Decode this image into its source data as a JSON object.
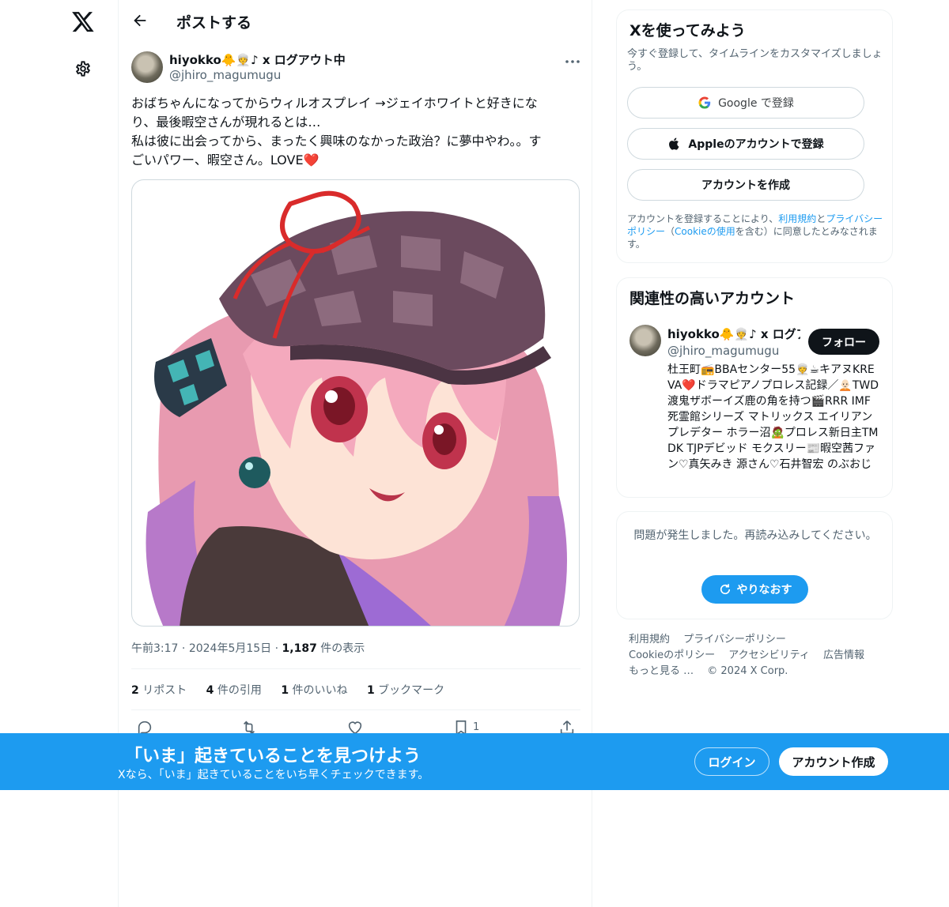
{
  "nav": {
    "logo_icon": "x-logo-icon",
    "settings_icon": "gear-icon"
  },
  "header": {
    "back_icon": "arrow-left-icon",
    "title": "ポストする"
  },
  "post": {
    "author_name": "hiyokko🐥👳‍♀️♪ x ログアウト中",
    "author_handle": "@jhiro_magumugu",
    "text": "おばちゃんになってからウィルオスプレイ →ジェイホワイトと好きにな\nり、最後暇空さんが現れるとは…\n私は彼に出会ってから、まったく興味のなかった政治？に夢中やわ。。す\nごいパワー、暇空さん。LOVE❤️",
    "time": "午前3:17",
    "date": "2024年5月15日",
    "views_count": "1,187",
    "views_label": "件の表示",
    "stats": [
      {
        "count": "2",
        "label": "リポスト"
      },
      {
        "count": "4",
        "label": "件の引用"
      },
      {
        "count": "1",
        "label": "件のいいね"
      },
      {
        "count": "1",
        "label": "ブックマーク"
      }
    ],
    "bookmark_count": "1",
    "image_alt": "anime girl with pink hair and checkered cap"
  },
  "signup_card": {
    "title": "Xを使ってみよう",
    "subtitle": "今すぐ登録して、タイムラインをカスタマイズしましょう。",
    "google_label": "Google で登録",
    "apple_label": "Appleのアカウントで登録",
    "create_label": "アカウントを作成",
    "legal_prefix": "アカウントを登録することにより、",
    "legal_terms": "利用規約",
    "legal_and": "と",
    "legal_privacy": "プライバシーポリシー",
    "legal_open": "（",
    "legal_cookie": "Cookieの使用",
    "legal_suffix": "を含む）に同意したとみなされます。"
  },
  "related_card": {
    "title": "関連性の高いアカウント",
    "name": "hiyokko🐥👳‍♀️♪ x ログアウト中",
    "handle": "@jhiro_magumugu",
    "follow_label": "フォロー",
    "bio": "杜王町📻BBAセンター55👳‍♀️☕キアヌKREVA❤️ドラマピアノプロレス記録／🧑🏻‍🦲TWD渡鬼ザボーイズ鹿の角を持つ🎬RRR IMF 死霊館シリーズ マトリックス エイリアンプレデター ホラー沼🧟プロレス新日主TMDK TJPデビッド モクスリー📰暇空茜ファン♡真矢みき 源さん♡石井智宏 のぶおじ"
  },
  "error_card": {
    "message": "問題が発生しました。再読み込みしてください。",
    "retry_label": "やりなおす"
  },
  "footer": {
    "links": [
      "利用規約",
      "プライバシーポリシー",
      "Cookieのポリシー",
      "アクセシビリティ",
      "広告情報",
      "もっと見る …"
    ],
    "copyright": "© 2024 X Corp."
  },
  "banner": {
    "title": "「いま」起きていることを見つけよう",
    "subtitle": "Xなら、「いま」起きていることをいち早くチェックできます。",
    "login_label": "ログイン",
    "signup_label": "アカウント作成"
  },
  "colors": {
    "accent": "#1d9bf0",
    "text": "#0f1419",
    "muted": "#536471",
    "border": "#eff3f4"
  }
}
